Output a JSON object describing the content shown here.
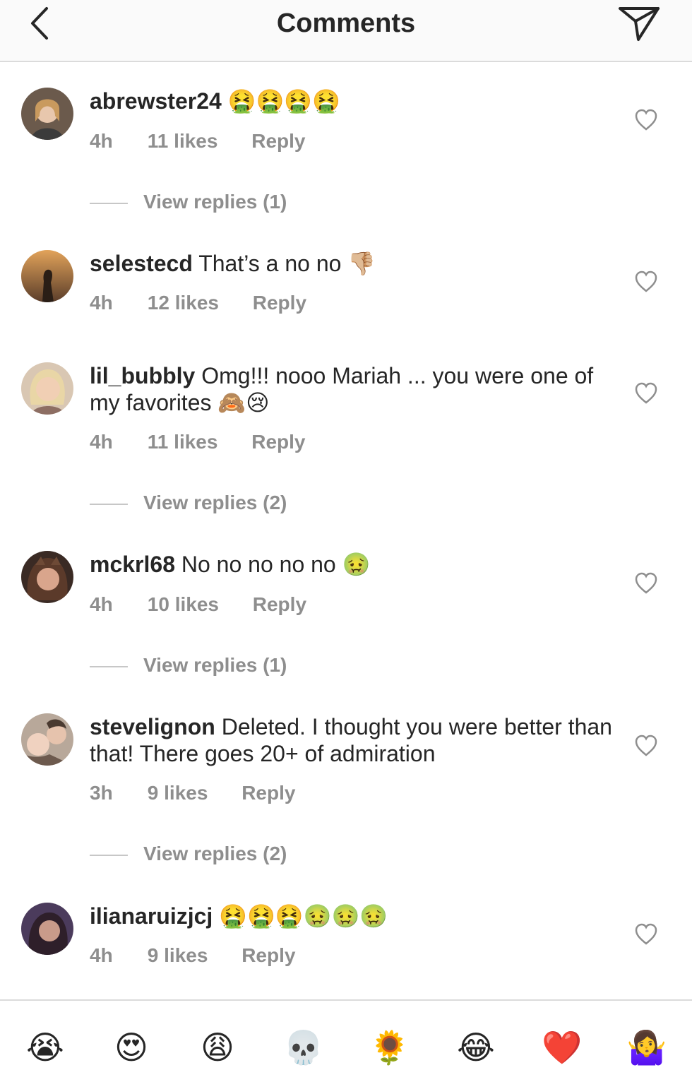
{
  "header": {
    "title": "Comments"
  },
  "comments": [
    {
      "username": "abrewster24",
      "text": "🤮🤮🤮🤮",
      "time": "4h",
      "likes": "11 likes",
      "reply": "Reply",
      "view_replies": "View replies (1)"
    },
    {
      "username": "selestecd",
      "text": "That’s a no no 👎🏼",
      "time": "4h",
      "likes": "12 likes",
      "reply": "Reply"
    },
    {
      "username": "lil_bubbly",
      "text": "Omg!!! nooo Mariah ... you were one of my favorites 🙈😢",
      "time": "4h",
      "likes": "11 likes",
      "reply": "Reply",
      "view_replies": "View replies (2)"
    },
    {
      "username": "mckrl68",
      "text": "No no no no no 🤢",
      "time": "4h",
      "likes": "10 likes",
      "reply": "Reply",
      "view_replies": "View replies (1)"
    },
    {
      "username": "stevelignon",
      "text": "Deleted.  I thought you were better than that!  There goes 20+ of admiration",
      "time": "3h",
      "likes": "9 likes",
      "reply": "Reply",
      "view_replies": "View replies (2)"
    },
    {
      "username": "ilianaruizjcj",
      "text": "🤮🤮🤮🤢🤢🤢",
      "time": "4h",
      "likes": "9 likes",
      "reply": "Reply"
    }
  ],
  "emoji_bar": [
    "😭",
    "😍",
    "😩",
    "💀",
    "🌻",
    "😂",
    "❤️",
    "🤷‍♀️"
  ],
  "colors": {
    "text_primary": "#262626",
    "text_secondary": "#8e8e8e",
    "divider": "#dbdbdb",
    "header_bg": "#fafafa"
  },
  "icons": {
    "back": "chevron-left-icon",
    "send": "paper-plane-icon",
    "like": "heart-outline-icon"
  }
}
